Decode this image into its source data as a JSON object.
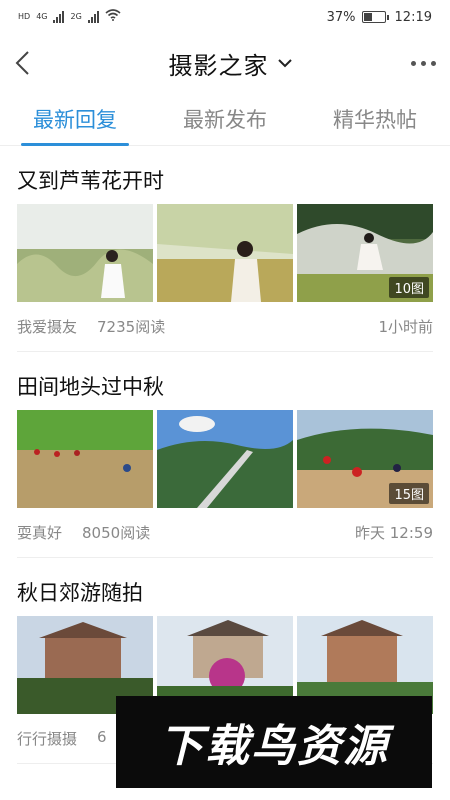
{
  "status_bar": {
    "hd_label": "HD",
    "net1_label": "4G",
    "net2_label": "2G",
    "battery": "37%",
    "time": "12:19"
  },
  "nav": {
    "title": "摄影之家",
    "icons": {
      "back": "back-chevron-icon",
      "dropdown": "chevron-down-icon",
      "more": "more-dots-icon"
    }
  },
  "tabs": [
    {
      "label": "最新回复",
      "active": true
    },
    {
      "label": "最新发布",
      "active": false
    },
    {
      "label": "精华热帖",
      "active": false
    }
  ],
  "posts": [
    {
      "title": "又到芦苇花开时",
      "author": "我爱摄友",
      "reads": "7235阅读",
      "time": "1小时前",
      "image_count": "10图"
    },
    {
      "title": "田间地头过中秋",
      "author": "耍真好",
      "reads": "8050阅读",
      "time": "昨天 12:59",
      "image_count": "15图"
    },
    {
      "title": "秋日郊游随拍",
      "author": "行行摄摄",
      "reads": "6",
      "time": ""
    }
  ],
  "watermark": {
    "text": "下载鸟资源"
  },
  "colors": {
    "accent": "#2c8fd9",
    "meta_text": "#888888"
  }
}
